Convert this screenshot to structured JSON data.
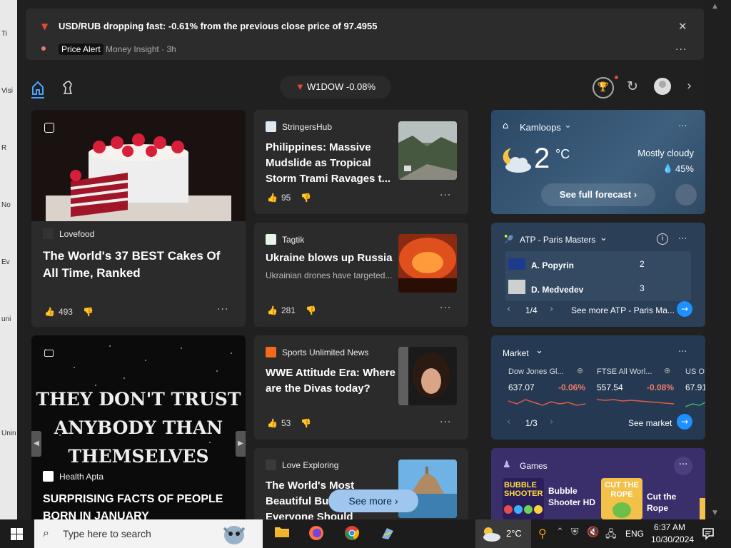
{
  "desktop_fragments": [
    "Ti",
    "Visi",
    "R",
    "No",
    "Ev",
    "uni",
    "Unin"
  ],
  "alert": {
    "title": "USD/RUB dropping fast: -0.61% from the previous close price of 97.4955",
    "badge": "Price Alert",
    "meta": "Money Insight · 3h",
    "close": "✕",
    "more": "···"
  },
  "nav": {
    "ticker_label": "W1DOW -0.08%",
    "ticker_arrow": "▼"
  },
  "cards": {
    "cakes": {
      "source": "Lovefood",
      "headline": "The World's 37 BEST Cakes Of All Time, Ranked",
      "likes": "493"
    },
    "stringers": {
      "source": "StringersHub",
      "headline": "Philippines: Massive Mudslide as Tropical Storm Trami Ravages t...",
      "likes": "95"
    },
    "tagtik": {
      "source": "Tagtik",
      "headline": "Ukraine blows up Russia",
      "snippet": "Ukrainian drones have targeted...",
      "likes": "281"
    },
    "wwe": {
      "source": "Sports Unlimited News",
      "headline": "WWE Attitude Era: Where are the Divas today?",
      "likes": "53"
    },
    "health": {
      "source": "Health Apta",
      "headline": "SURPRISING FACTS OF PEOPLE BORN IN JANUARY",
      "image_text": [
        "THEY DON'T TRUST",
        "ANYBODY THAN",
        "THEMSELVES"
      ]
    },
    "love": {
      "source": "Love Exploring",
      "headline": "The World's Most Beautiful Bu Everyone Should See"
    }
  },
  "see_more": "See more",
  "weather": {
    "location": "Kamloops",
    "temp": "2",
    "unit": "°C",
    "condition": "Mostly cloudy",
    "precip": "45%",
    "forecast_button": "See full forecast"
  },
  "atp": {
    "title": "ATP - Paris Masters",
    "players": [
      {
        "name": "A. Popyrin",
        "score": "2"
      },
      {
        "name": "D. Medvedev",
        "score": "3"
      }
    ],
    "page": "1/4",
    "link": "See more ATP - Paris Ma..."
  },
  "market": {
    "title": "Market",
    "items": [
      {
        "name": "Dow Jones Gl...",
        "value": "637.07",
        "change": "-0.06%"
      },
      {
        "name": "FTSE All Worl...",
        "value": "557.54",
        "change": "-0.08%"
      },
      {
        "name": "US O",
        "value": "67.91",
        "change": ""
      }
    ],
    "page": "1/3",
    "link": "See market"
  },
  "games": {
    "title": "Games",
    "items": [
      {
        "name": "Bubble Shooter HD",
        "logo": "BUBBLE SHOOTER"
      },
      {
        "name": "Cut the Rope",
        "logo": "CUT THE ROPE"
      }
    ]
  },
  "taskbar": {
    "search_placeholder": "Type here to search",
    "temp": "2°C",
    "lang": "ENG",
    "time": "6:37 AM",
    "date": "10/30/2024"
  },
  "colors": {
    "accent": "#4aa3ff",
    "negative": "#f07a6a",
    "alert_red": "#e04b3a"
  }
}
